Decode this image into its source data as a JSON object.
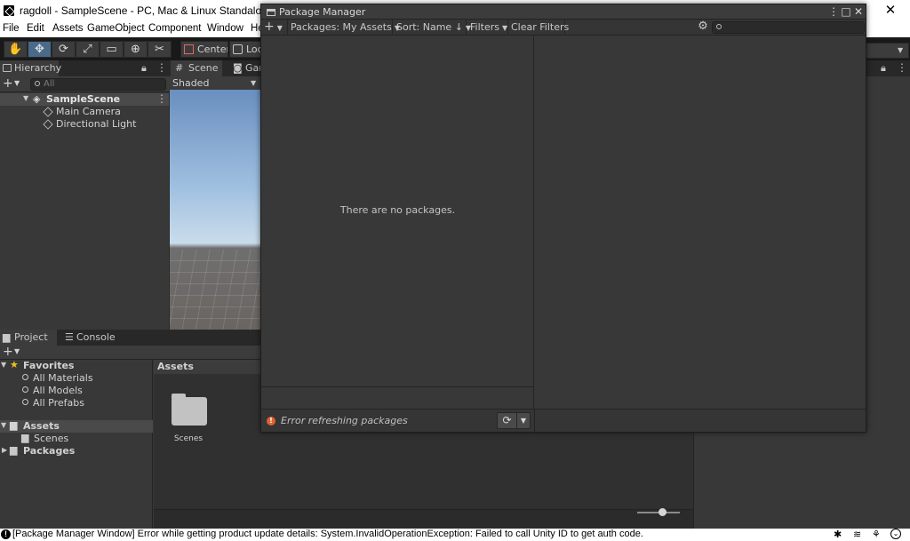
{
  "window": {
    "title": "ragdoll - SampleScene - PC, Mac & Linux Standalone - Unity",
    "close": "✕"
  },
  "menu": [
    "File",
    "Edit",
    "Assets",
    "GameObject",
    "Component",
    "Window",
    "He"
  ],
  "toolbar": {
    "center_label": "Center",
    "local_label": "Loc"
  },
  "hierarchy": {
    "tab": "Hierarchy",
    "search_placeholder": "All",
    "scene": "SampleScene",
    "items": [
      "Main Camera",
      "Directional Light"
    ]
  },
  "scene_panel": {
    "tab_scene": "Scene",
    "tab_game": "Gar",
    "shading": "Shaded"
  },
  "project": {
    "tab_project": "Project",
    "tab_console": "Console",
    "favorites": {
      "label": "Favorites",
      "items": [
        "All Materials",
        "All Models",
        "All Prefabs"
      ]
    },
    "tree": {
      "assets": "Assets",
      "scenes": "Scenes",
      "packages": "Packages"
    },
    "assets_header": "Assets",
    "assets": [
      {
        "name": "Scenes"
      }
    ],
    "zoom_slider": 0.5
  },
  "package_manager": {
    "title": "Package Manager",
    "add_label": "+",
    "packages_filter": "Packages: My Assets",
    "sort": "Sort: Name ↓",
    "filters": "Filters",
    "clear_filters": "Clear Filters",
    "search_placeholder": "",
    "empty_message": "There are no packages.",
    "error_message": "Error refreshing packages"
  },
  "status_bar": {
    "message": "[Package Manager Window] Error while getting product update details: System.InvalidOperationException: Failed to call Unity ID to get auth code."
  }
}
